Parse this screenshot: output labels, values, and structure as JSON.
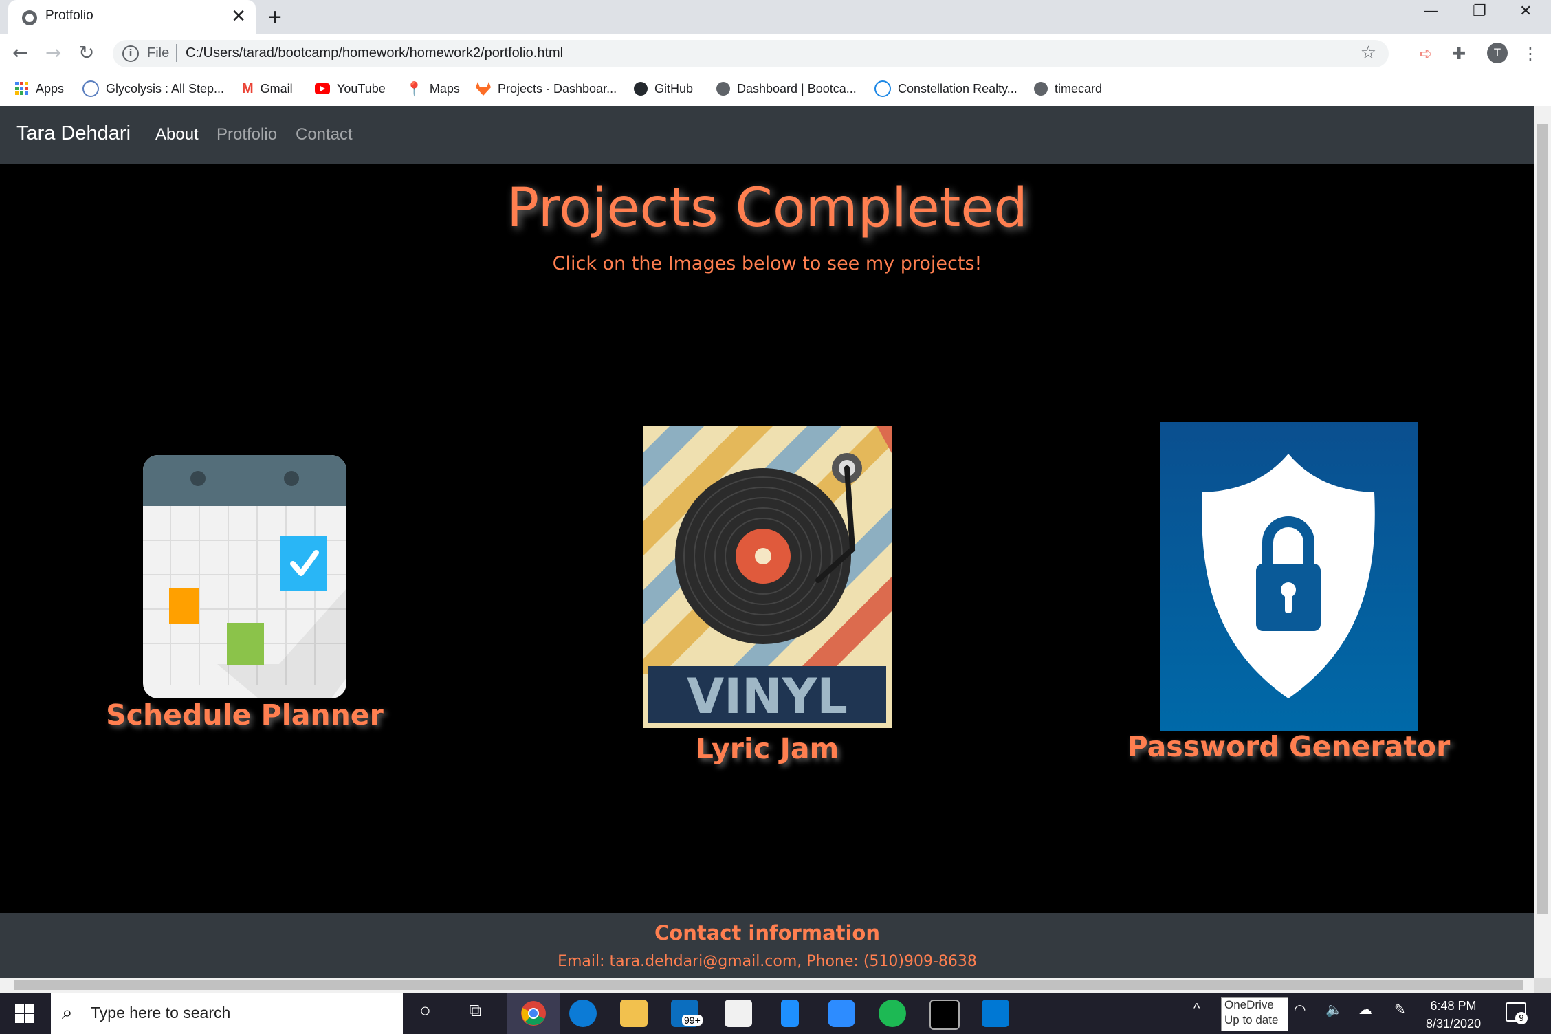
{
  "browser": {
    "tab_title": "Protfolio",
    "new_tab_label": "+",
    "file_label": "File",
    "url": "C:/Users/tarad/bootcamp/homework/homework2/portfolio.html",
    "profile_initial": "T",
    "bookmarks": [
      {
        "label": "Apps",
        "icon": "apps-grid-icon",
        "color": "#4285f4"
      },
      {
        "label": "Glycolysis : All Step...",
        "icon": "glycolysis-icon",
        "color": "#5b7fbf"
      },
      {
        "label": "Gmail",
        "icon": "gmail-icon",
        "color": "#ea4335"
      },
      {
        "label": "YouTube",
        "icon": "youtube-icon",
        "color": "#ff0000"
      },
      {
        "label": "Maps",
        "icon": "maps-pin-icon",
        "color": "#34a853"
      },
      {
        "label": "Projects · Dashboar...",
        "icon": "gitlab-icon",
        "color": "#fc6d26"
      },
      {
        "label": "GitHub",
        "icon": "github-icon",
        "color": "#24292e"
      },
      {
        "label": "Dashboard | Bootca...",
        "icon": "globe-icon",
        "color": "#5f6368"
      },
      {
        "label": "Constellation Realty...",
        "icon": "constellation-icon",
        "color": "#1e88e5"
      },
      {
        "label": "timecard",
        "icon": "globe-icon",
        "color": "#5f6368"
      }
    ]
  },
  "site": {
    "brand": "Tara Dehdari",
    "nav": [
      {
        "label": "About",
        "active": true
      },
      {
        "label": "Protfolio",
        "active": false
      },
      {
        "label": "Contact",
        "active": false
      }
    ],
    "heading": "Projects Completed",
    "subheading": "Click on the Images below to see my projects!",
    "projects": [
      {
        "caption": "Schedule Planner",
        "image": "calendar-icon"
      },
      {
        "caption": "Lyric Jam",
        "image": "vinyl-record-icon",
        "image_text": "VINYL"
      },
      {
        "caption": "Password Generator",
        "image": "shield-lock-icon"
      }
    ],
    "footer": {
      "title": "Contact information",
      "line": "Email: tara.dehdari@gmail.com, Phone: (510)909-8638"
    },
    "accent_color": "#ff7f50"
  },
  "taskbar": {
    "search_placeholder": "Type here to search",
    "mail_badge": "99+",
    "onedrive_line1": "OneDrive",
    "onedrive_line2": "Up to date",
    "time": "6:48 PM",
    "date": "8/31/2020",
    "notification_count": "9"
  }
}
